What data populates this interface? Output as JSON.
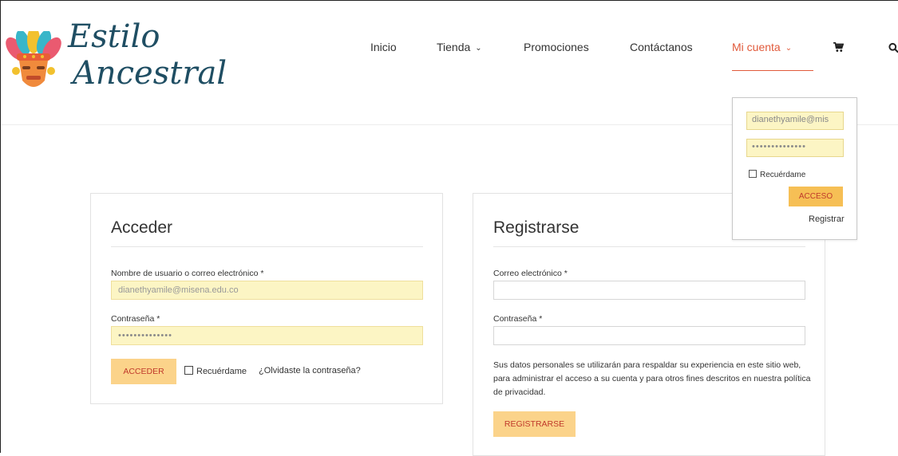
{
  "brand": {
    "line1": "Estilo",
    "line2": "Ancestral"
  },
  "nav": {
    "items": [
      {
        "label": "Inicio"
      },
      {
        "label": "Tienda"
      },
      {
        "label": "Promociones"
      },
      {
        "label": "Contáctanos"
      },
      {
        "label": "Mi cuenta"
      }
    ],
    "active": "Mi cuenta",
    "accent_color": "#e15a3b"
  },
  "dropdown": {
    "username_value": "dianethyamile@mis",
    "password_value": "••••••••••••••",
    "remember_label": "Recuérdame",
    "submit_label": "ACCESO",
    "register_link": "Registrar"
  },
  "login": {
    "title": "Acceder",
    "username_label": "Nombre de usuario o correo electrónico *",
    "username_value": "dianethyamile@misena.edu.co",
    "password_label": "Contraseña *",
    "password_value": "••••••••••••••",
    "submit_label": "ACCEDER",
    "remember_label": "Recuérdame",
    "forgot_link": "¿Olvidaste la contraseña?"
  },
  "register": {
    "title": "Registrarse",
    "email_label": "Correo electrónico *",
    "password_label": "Contraseña *",
    "privacy_text": "Sus datos personales se utilizarán para respaldar su experiencia en este sitio web, para administrar el acceso a su cuenta y para otros fines descritos en nuestra política de privacidad.",
    "submit_label": "REGISTRARSE"
  },
  "colors": {
    "button_bg": "#fbd38a",
    "button_text": "#c0392b",
    "autofill_bg": "#fcf5c4"
  }
}
